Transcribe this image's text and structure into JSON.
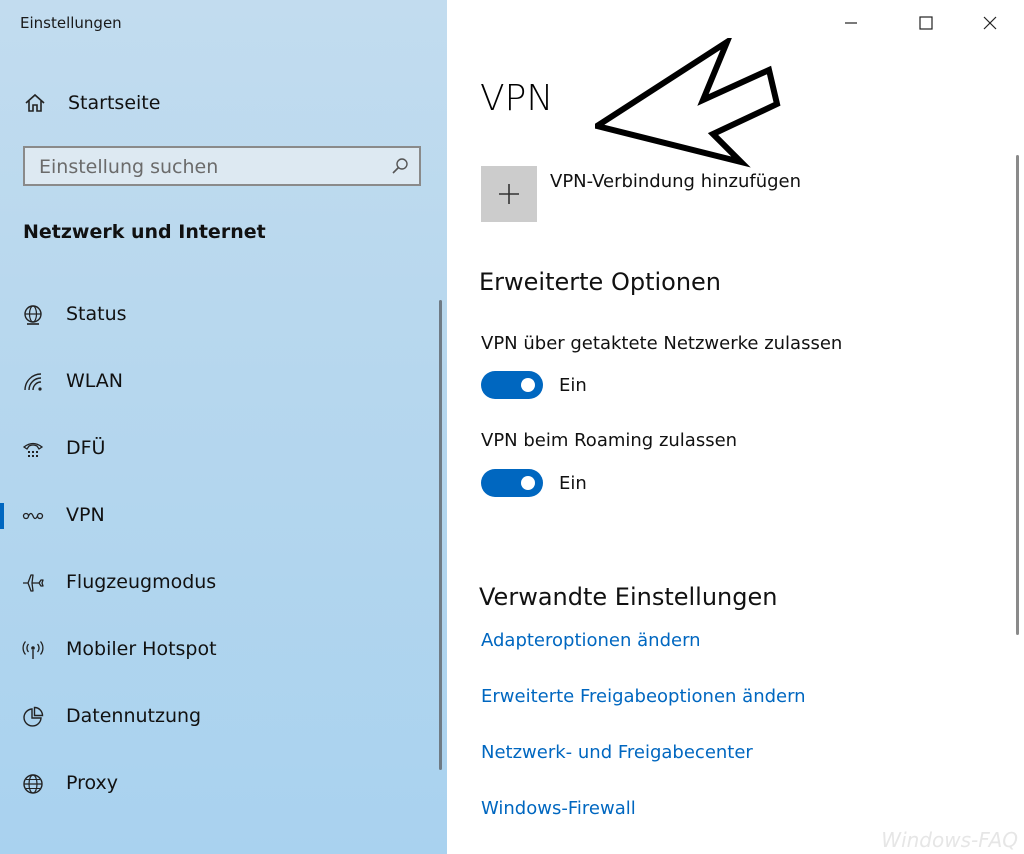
{
  "window": {
    "title": "Einstellungen"
  },
  "sidebar": {
    "home": "Startseite",
    "search_placeholder": "Einstellung suchen",
    "section_title": "Netzwerk und Internet",
    "items": [
      {
        "label": "Status",
        "icon": "globe-monitor-icon"
      },
      {
        "label": "WLAN",
        "icon": "wifi-icon"
      },
      {
        "label": "DFÜ",
        "icon": "dialup-phone-icon"
      },
      {
        "label": "VPN",
        "icon": "vpn-icon",
        "selected": true
      },
      {
        "label": "Flugzeugmodus",
        "icon": "airplane-icon"
      },
      {
        "label": "Mobiler Hotspot",
        "icon": "hotspot-icon"
      },
      {
        "label": "Datennutzung",
        "icon": "pie-chart-icon"
      },
      {
        "label": "Proxy",
        "icon": "globe-icon"
      }
    ]
  },
  "main": {
    "title": "VPN",
    "add_vpn": "VPN-Verbindung hinzufügen",
    "advanced_title": "Erweiterte Optionen",
    "options": [
      {
        "label": "VPN über getaktete Netzwerke zulassen",
        "state": "Ein",
        "on": true
      },
      {
        "label": "VPN beim Roaming zulassen",
        "state": "Ein",
        "on": true
      }
    ],
    "related_title": "Verwandte Einstellungen",
    "links": [
      "Adapteroptionen ändern",
      "Erweiterte Freigabeoptionen ändern",
      "Netzwerk- und Freigabecenter",
      "Windows-Firewall"
    ]
  },
  "watermark": "Windows-FAQ",
  "colors": {
    "accent": "#0067c0",
    "sidebar": "#b6d7ee"
  }
}
